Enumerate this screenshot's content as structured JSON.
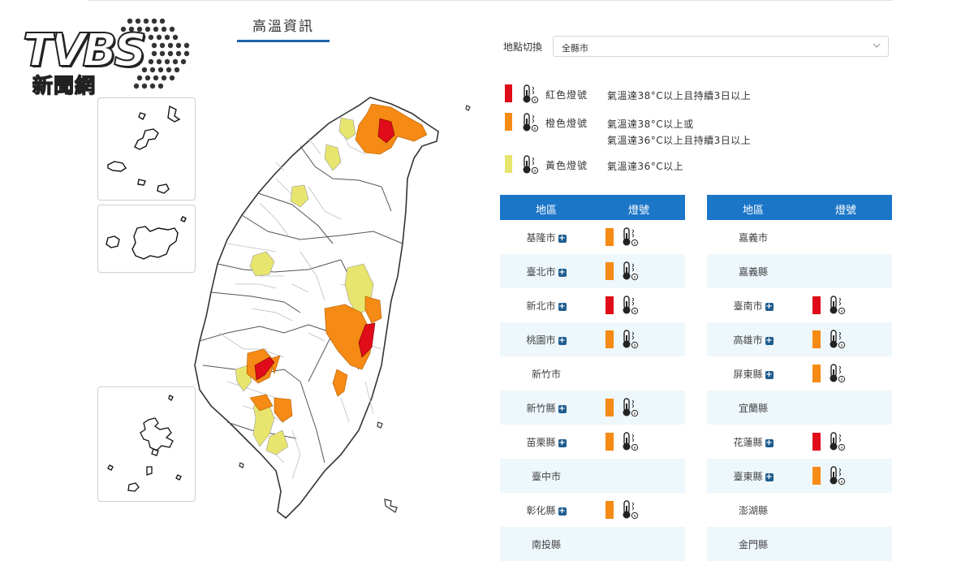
{
  "logo": {
    "brand": "TVBS",
    "sub": "新聞網"
  },
  "page_title": "高溫資訊",
  "location": {
    "label": "地點切換",
    "selected": "全縣市"
  },
  "colors": {
    "red": "#e00c1a",
    "orange": "#f58a14",
    "yellow": "#e8e56e",
    "header_blue": "#1b76c8"
  },
  "legend": [
    {
      "level": "red",
      "name": "紅色燈號",
      "desc": [
        "氣溫達38°C以上且持續3日以上"
      ]
    },
    {
      "level": "orange",
      "name": "橙色燈號",
      "desc": [
        "氣溫達38°C以上或",
        "氣溫達36°C以上且持續3日以上"
      ]
    },
    {
      "level": "yellow",
      "name": "黃色燈號",
      "desc": [
        "氣溫達36°C以上"
      ]
    }
  ],
  "table_headers": {
    "area": "地區",
    "signal": "燈號"
  },
  "table_left": [
    {
      "name": "基隆市",
      "level": "orange"
    },
    {
      "name": "臺北市",
      "level": "orange"
    },
    {
      "name": "新北市",
      "level": "red"
    },
    {
      "name": "桃園市",
      "level": "orange"
    },
    {
      "name": "新竹市",
      "level": ""
    },
    {
      "name": "新竹縣",
      "level": "orange"
    },
    {
      "name": "苗栗縣",
      "level": "orange"
    },
    {
      "name": "臺中市",
      "level": ""
    },
    {
      "name": "彰化縣",
      "level": "orange"
    },
    {
      "name": "南投縣",
      "level": ""
    }
  ],
  "table_right": [
    {
      "name": "嘉義市",
      "level": ""
    },
    {
      "name": "嘉義縣",
      "level": ""
    },
    {
      "name": "臺南市",
      "level": "red"
    },
    {
      "name": "高雄市",
      "level": "orange"
    },
    {
      "name": "屏東縣",
      "level": "orange"
    },
    {
      "name": "宜蘭縣",
      "level": ""
    },
    {
      "name": "花蓮縣",
      "level": "red"
    },
    {
      "name": "臺東縣",
      "level": "orange"
    },
    {
      "name": "澎湖縣",
      "level": ""
    },
    {
      "name": "金門縣",
      "level": ""
    }
  ]
}
